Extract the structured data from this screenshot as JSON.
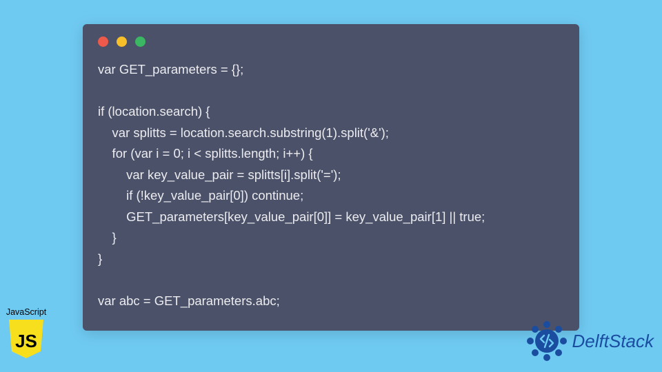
{
  "code": {
    "lines": [
      "var GET_parameters = {};",
      "",
      "if (location.search) {",
      "    var splitts = location.search.substring(1).split('&');",
      "    for (var i = 0; i < splitts.length; i++) {",
      "        var key_value_pair = splitts[i].split('=');",
      "        if (!key_value_pair[0]) continue;",
      "        GET_parameters[key_value_pair[0]] = key_value_pair[1] || true;",
      "    }",
      "}",
      "",
      "var abc = GET_parameters.abc;"
    ]
  },
  "badge": {
    "label": "JavaScript",
    "logo_text": "JS"
  },
  "brand": {
    "name": "DelftStack"
  },
  "colors": {
    "page_bg": "#6fcaf2",
    "window_bg": "#4a5168",
    "code_text": "#ececf0",
    "js_shield": "#f7df1e",
    "brand_blue": "#1a4da0"
  }
}
